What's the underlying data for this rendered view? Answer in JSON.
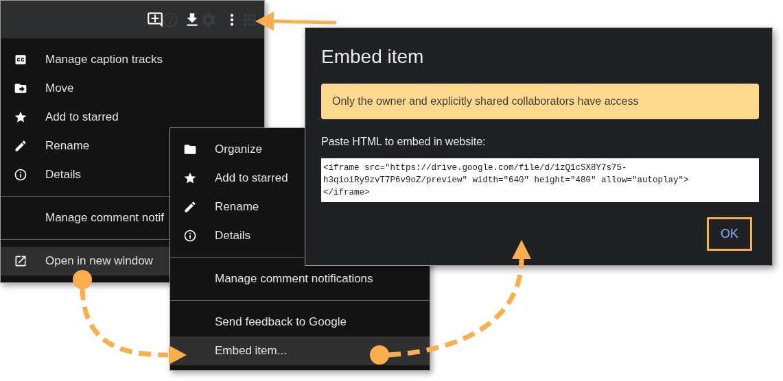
{
  "drive_menu": {
    "groups": [
      [
        {
          "label": "Manage caption tracks",
          "selected": false
        },
        {
          "label": "Move",
          "selected": false
        },
        {
          "label": "Add to starred",
          "selected": false
        },
        {
          "label": "Rename",
          "selected": false
        },
        {
          "label": "Details",
          "selected": false
        }
      ],
      [
        {
          "label": "Manage comment notif",
          "selected": false
        }
      ],
      [
        {
          "label": "Open in new window",
          "selected": true
        }
      ]
    ]
  },
  "more_menu": {
    "groups": [
      [
        {
          "label": "Organize",
          "selected": false
        },
        {
          "label": "Add to starred",
          "selected": false
        },
        {
          "label": "Rename",
          "selected": false
        },
        {
          "label": "Details",
          "selected": false
        }
      ],
      [
        {
          "label": "Manage comment notifications",
          "selected": false
        }
      ],
      [
        {
          "label": "Send feedback to Google",
          "selected": false
        },
        {
          "label": "Embed item...",
          "selected": true
        }
      ]
    ]
  },
  "dialog": {
    "title": "Embed item",
    "notice": "Only the owner and explicitly shared collaborators have access",
    "label": "Paste HTML to embed in website:",
    "code_lines": [
      "<iframe src=\"https://drive.google.com/file/d/1zQ1cSX8Y7s75-",
      "h3qioiRy9zvT7P6v9oZ/preview\" width=\"640\" height=\"480\" allow=\"autoplay\">",
      "</iframe>"
    ],
    "ok_button": {
      "label": "OK",
      "highlighted": true
    }
  }
}
